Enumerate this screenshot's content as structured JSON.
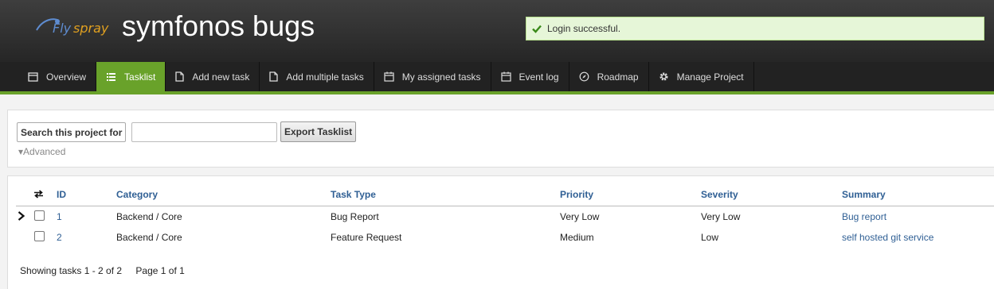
{
  "header": {
    "logo": {
      "fly": "Fly",
      "spray": "spray"
    },
    "title": "symfonos bugs"
  },
  "flash": {
    "message": "Login successful.",
    "icon": "check-icon",
    "color": "#e6f6d8"
  },
  "nav": {
    "accent_color": "#69a22a",
    "items": [
      {
        "label": "Overview",
        "icon": "overview-icon"
      },
      {
        "label": "Tasklist",
        "icon": "list-icon",
        "active": true
      },
      {
        "label": "Add new task",
        "icon": "file-icon"
      },
      {
        "label": "Add multiple tasks",
        "icon": "file-icon"
      },
      {
        "label": "My assigned tasks",
        "icon": "calendar-icon"
      },
      {
        "label": "Event log",
        "icon": "calendar-icon"
      },
      {
        "label": "Roadmap",
        "icon": "compass-icon"
      },
      {
        "label": "Manage Project",
        "icon": "gear-icon"
      }
    ]
  },
  "search": {
    "label": "Search this project for",
    "value": "",
    "export_label": "Export Tasklist",
    "advanced_label": "▾Advanced"
  },
  "table": {
    "columns": [
      "ID",
      "Category",
      "Task Type",
      "Priority",
      "Severity",
      "Summary"
    ],
    "rows": [
      {
        "id": "1",
        "category": "Backend / Core",
        "task_type": "Bug Report",
        "priority": "Very Low",
        "severity": "Very Low",
        "summary": "Bug report"
      },
      {
        "id": "2",
        "category": "Backend / Core",
        "task_type": "Feature Request",
        "priority": "Medium",
        "severity": "Low",
        "summary": "self hosted git service"
      }
    ],
    "showing": "Showing tasks 1 - 2 of 2",
    "page": "Page 1 of 1"
  }
}
